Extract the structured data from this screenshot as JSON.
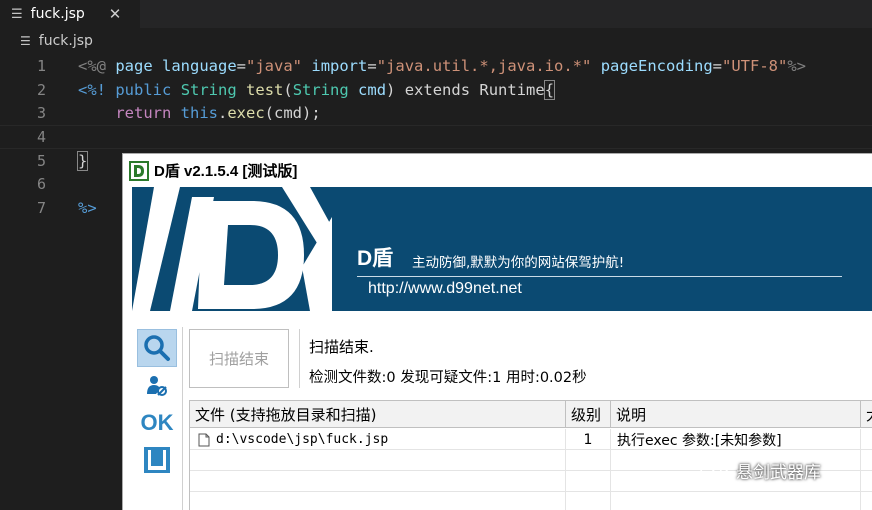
{
  "editor": {
    "tab": {
      "label": "fuck.jsp",
      "close_icon": "close-icon"
    },
    "breadcrumb": {
      "label": "fuck.jsp"
    },
    "lines": [
      {
        "num": "1",
        "tokens": [
          [
            "<%@",
            "gray"
          ],
          [
            " ",
            "text"
          ],
          [
            "page",
            "lblue"
          ],
          [
            " ",
            "text"
          ],
          [
            "language",
            "lblue"
          ],
          [
            "=",
            "text"
          ],
          [
            "\"java\"",
            "str"
          ],
          [
            " ",
            "text"
          ],
          [
            "import",
            "lblue"
          ],
          [
            "=",
            "text"
          ],
          [
            "\"java.util.*,java.io.*\"",
            "str"
          ],
          [
            " ",
            "text"
          ],
          [
            "pageEncoding",
            "lblue"
          ],
          [
            "=",
            "text"
          ],
          [
            "\"UTF-8\"",
            "str"
          ],
          [
            "%>",
            "gray"
          ]
        ]
      },
      {
        "num": "2",
        "tokens": [
          [
            "<%!",
            "blue"
          ],
          [
            " ",
            "text"
          ],
          [
            "public",
            "blue"
          ],
          [
            " ",
            "text"
          ],
          [
            "String",
            "type"
          ],
          [
            " ",
            "text"
          ],
          [
            "test",
            "fn"
          ],
          [
            "(",
            "text"
          ],
          [
            "String",
            "type"
          ],
          [
            " ",
            "text"
          ],
          [
            "cmd",
            "lblue"
          ],
          [
            ") ",
            "text"
          ],
          [
            "extends",
            "text"
          ],
          [
            " ",
            "text"
          ],
          [
            "Runtime",
            "text"
          ],
          [
            "{",
            "box"
          ]
        ]
      },
      {
        "num": "3",
        "tokens": [
          [
            "    ",
            "text"
          ],
          [
            "return",
            "purple"
          ],
          [
            " ",
            "text"
          ],
          [
            "this",
            "blue"
          ],
          [
            ".",
            "text"
          ],
          [
            "exec",
            "fn"
          ],
          [
            "(cmd);",
            "text"
          ]
        ]
      },
      {
        "num": "4",
        "tokens": []
      },
      {
        "num": "5",
        "tokens": [
          [
            "}",
            "box"
          ]
        ]
      },
      {
        "num": "6",
        "tokens": []
      },
      {
        "num": "7",
        "tokens": [
          [
            "%>",
            "blue"
          ]
        ]
      }
    ]
  },
  "dshield": {
    "title": "D盾 v2.1.5.4 [测试版]",
    "banner": {
      "brand": "D盾",
      "slogan": "主动防御,默默为你的网站保驾护航!",
      "url": "http://www.d99net.net"
    },
    "tools": [
      {
        "name": "search-icon"
      },
      {
        "name": "user-scan-icon"
      },
      {
        "name": "ok-icon",
        "label": "OK"
      },
      {
        "name": "frame-icon"
      }
    ],
    "scan_button": "扫描结束",
    "status_line1": "扫描结束.",
    "status_line2": "检测文件数:0 发现可疑文件:1 用时:0.02秒",
    "table": {
      "columns": [
        "文件 (支持拖放目录和扫描)",
        "级别",
        "说明",
        "大"
      ],
      "rows": [
        {
          "file": "d:\\vscode\\jsp\\fuck.jsp",
          "level": "1",
          "desc": "执行exec 参数:[未知参数]"
        }
      ]
    }
  },
  "watermark": {
    "text": "悬剑武器库"
  }
}
